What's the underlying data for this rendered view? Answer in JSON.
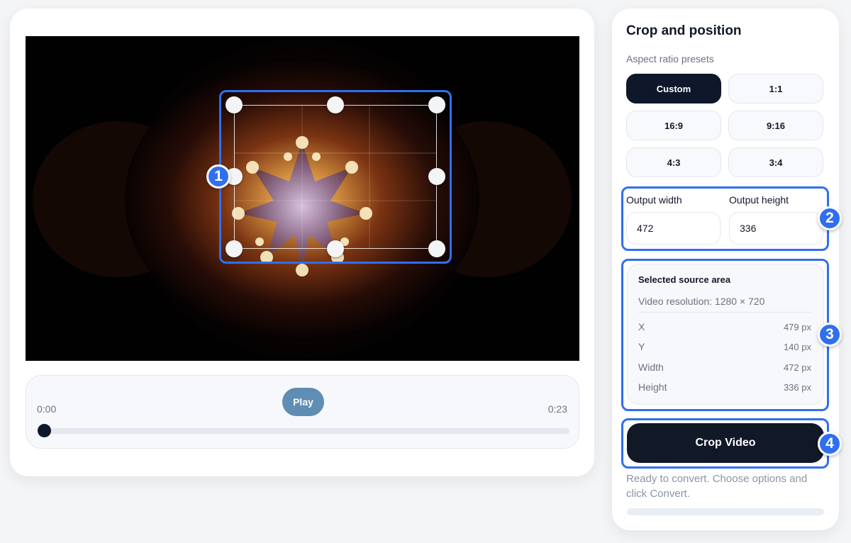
{
  "editor": {
    "timeline": {
      "play_label": "Play",
      "current_time": "0:00",
      "duration": "0:23",
      "progress": 0.0
    }
  },
  "panel": {
    "title": "Crop and position",
    "presets_label": "Aspect ratio presets",
    "presets": [
      "Custom",
      "1:1",
      "16:9",
      "9:16",
      "4:3",
      "3:4"
    ],
    "active_preset": "Custom",
    "output_width_label": "Output width",
    "output_height_label": "Output height",
    "output_width": "472",
    "output_height": "336",
    "source": {
      "title": "Selected source area",
      "resolution": "Video resolution: 1280 × 720",
      "rows": [
        {
          "label": "X",
          "value": "479 px"
        },
        {
          "label": "Y",
          "value": "140 px"
        },
        {
          "label": "Width",
          "value": "472 px"
        },
        {
          "label": "Height",
          "value": "336 px"
        }
      ]
    },
    "crop_button": "Crop Video",
    "status": "Ready to convert. Choose options and click Convert."
  },
  "annotations": [
    "1",
    "2",
    "3",
    "4"
  ],
  "colors": {
    "accent": "#2f6ff0",
    "primary_dark": "#0f172a",
    "play": "#5f8db4"
  }
}
